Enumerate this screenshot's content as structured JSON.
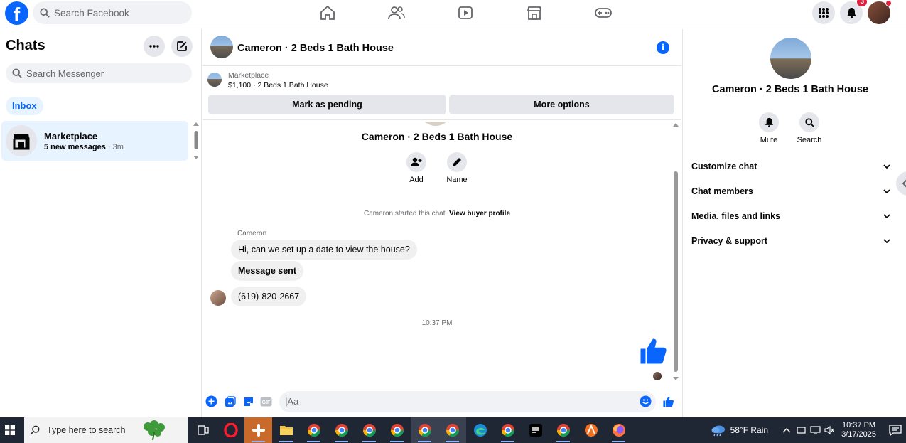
{
  "topbar": {
    "logo_letter": "f",
    "search_placeholder": "Search Facebook",
    "nav": [
      "home-icon",
      "friends-icon",
      "video-icon",
      "marketplace-icon",
      "gaming-icon"
    ],
    "notifications_count": "3"
  },
  "left": {
    "title": "Chats",
    "search_placeholder": "Search Messenger",
    "filter_chip": "Inbox",
    "conversations": [
      {
        "name": "Marketplace",
        "summary": "5 new messages",
        "time": "· 3m"
      }
    ]
  },
  "center": {
    "header_title": "Cameron · 2 Beds 1 Bath House",
    "marketplace_label": "Marketplace",
    "listing": "$1,100 · 2 Beds 1 Bath House",
    "mark_pending": "Mark as pending",
    "more_options": "More options",
    "contact_title": "Cameron · 2 Beds 1 Bath House",
    "actions": {
      "add": "Add",
      "name": "Name"
    },
    "started_text": "Cameron started this chat.",
    "view_profile": "View buyer profile",
    "sender": "Cameron",
    "messages": [
      "Hi, can we set up a date to view the house?",
      "Message sent",
      "(619)-820-2667"
    ],
    "timestamp": "10:37 PM",
    "composer_placeholder": "Aa",
    "gif_label": "GIF"
  },
  "right": {
    "title": "Cameron · 2 Beds 1 Bath House",
    "mute": "Mute",
    "search": "Search",
    "sections": [
      "Customize chat",
      "Chat members",
      "Media, files and links",
      "Privacy & support"
    ]
  },
  "taskbar": {
    "search_placeholder": "Type here to search",
    "weather": "58°F  Rain",
    "time": "10:37 PM",
    "date": "3/17/2025"
  },
  "colors": {
    "accent": "#0866ff",
    "taskbar": "#1f2634"
  }
}
